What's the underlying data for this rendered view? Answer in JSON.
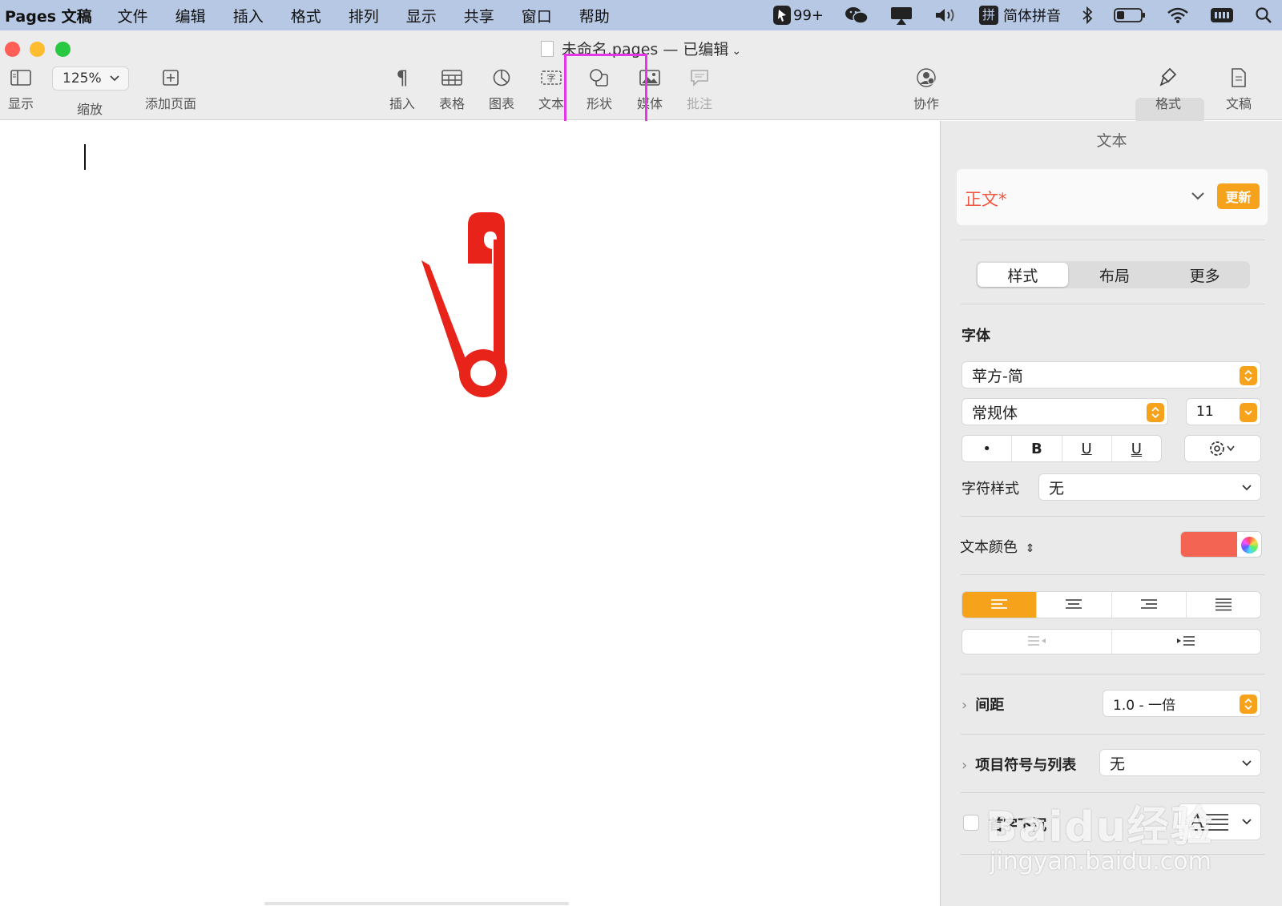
{
  "menubar": {
    "app_name": "Pages 文稿",
    "items": [
      "文件",
      "编辑",
      "插入",
      "格式",
      "排列",
      "显示",
      "共享",
      "窗口",
      "帮助"
    ],
    "status": {
      "notification_count": "99+",
      "input_method": "简体拼音"
    }
  },
  "window": {
    "title": "未命名.pages — 已编辑",
    "traffic_colors": {
      "close": "#ff5f57",
      "minimize": "#febc2e",
      "zoom": "#28c840"
    }
  },
  "toolbar": {
    "view_label": "显示",
    "zoom_value": "125%",
    "zoom_label": "缩放",
    "add_page_label": "添加页面",
    "insert_label": "插入",
    "table_label": "表格",
    "chart_label": "图表",
    "text_label": "文本",
    "shape_label": "形状",
    "media_label": "媒体",
    "comment_label": "批注",
    "collaborate_label": "协作",
    "format_label": "格式",
    "document_label": "文稿",
    "highlight_color": "#e536e8"
  },
  "canvas": {
    "shape_icon": "safety-pin-icon",
    "shape_color": "#e8231a"
  },
  "inspector": {
    "title": "文本",
    "paragraph_style": "正文*",
    "update_label": "更新",
    "tabs": [
      "样式",
      "布局",
      "更多"
    ],
    "active_tab": "样式",
    "font_section_label": "字体",
    "font_family": "苹方-简",
    "font_weight": "常规体",
    "font_size": "11",
    "format_buttons": [
      "•",
      "B",
      "U",
      "U"
    ],
    "char_style_label": "字符样式",
    "char_style_value": "无",
    "text_color_label": "文本颜色",
    "text_color": "#f46453",
    "alignment": [
      "left",
      "center",
      "right",
      "justify"
    ],
    "active_alignment": "left",
    "spacing_label": "间距",
    "spacing_value": "1.0 - 一倍",
    "bullets_label": "项目符号与列表",
    "bullets_value": "无",
    "drop_cap_label": "首字下沉",
    "accent_color": "#f6a31b"
  },
  "watermark": {
    "logo_text": "Baidu经验",
    "url": "jingyan.baidu.com"
  }
}
